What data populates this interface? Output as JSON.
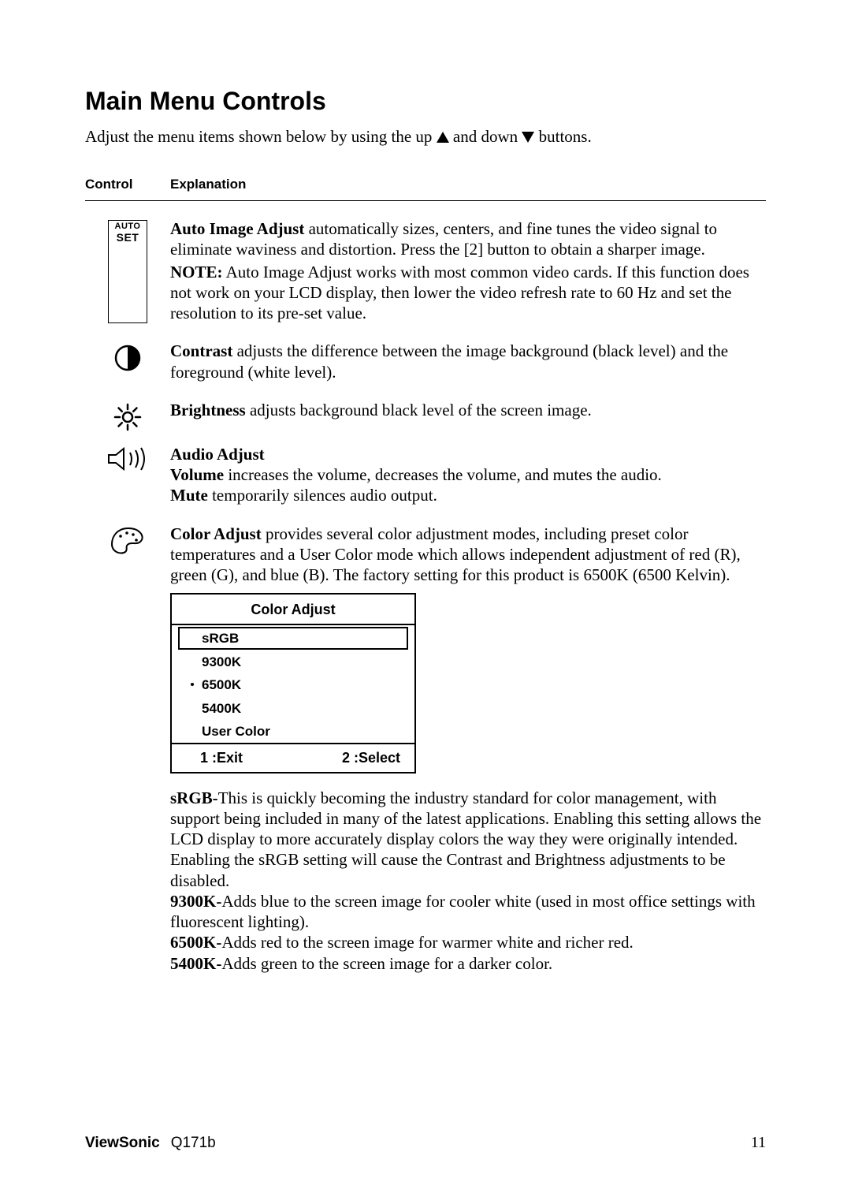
{
  "title": "Main Menu Controls",
  "intro_a": "Adjust the menu items shown below by using the up ",
  "intro_b": " and down ",
  "intro_c": " buttons.",
  "head": {
    "control": "Control",
    "explanation": "Explanation"
  },
  "autoset": {
    "l1": "AUTO",
    "l2": "SET"
  },
  "items": {
    "auto": {
      "title": "Auto Image Adjust",
      "rest": " automatically sizes, centers, and fine tunes the video signal to eliminate waviness and distortion. Press the [2] button to obtain a sharper image.",
      "note_b": "NOTE:",
      "note_rest": " Auto Image Adjust works with most common video cards. If this function does not work on your LCD display, then lower the video refresh rate to 60 Hz and set the resolution to its pre-set value."
    },
    "contrast": {
      "title": "Contrast",
      "rest": " adjusts the difference between the image background  (black level) and the foreground (white level)."
    },
    "brightness": {
      "title": "Brightness",
      "rest": " adjusts background black level of the screen image."
    },
    "audio": {
      "heading": "Audio Adjust",
      "vol_b": "Volume",
      "vol_rest": " increases the volume, decreases the volume, and mutes the audio.",
      "mute_b": "Mute",
      "mute_rest": " temporarily silences audio output."
    },
    "color": {
      "title": "Color Adjust",
      "rest": " provides several color adjustment modes, including preset color temperatures and a User Color mode which allows independent adjustment of red (R), green (G), and blue (B). The factory setting for this product is 6500K (6500 Kelvin)."
    }
  },
  "osd": {
    "title": "Color Adjust",
    "items": [
      "sRGB",
      "9300K",
      "6500K",
      "5400K",
      "User Color"
    ],
    "foot1": "1 :Exit",
    "foot2": "2 :Select"
  },
  "after": {
    "srgb_b": "sRGB-",
    "srgb_rest": "This is quickly becoming the industry standard for color management, with support being included in many of the latest applications. Enabling this setting allows the LCD display to more accurately display colors the way they were originally intended. Enabling the sRGB setting will cause the Contrast and Brightness adjustments to be disabled.",
    "k93_b": "9300K-",
    "k93_rest": "Adds blue to the screen image for cooler white (used in most office settings with fluorescent lighting).",
    "k65_b": "6500K-",
    "k65_rest": "Adds red to the screen image for warmer white and richer red.",
    "k54_b": "5400K-",
    "k54_rest": "Adds green to the screen image for a darker color."
  },
  "footer": {
    "brand": "ViewSonic",
    "model": "Q171b",
    "page": "11"
  }
}
